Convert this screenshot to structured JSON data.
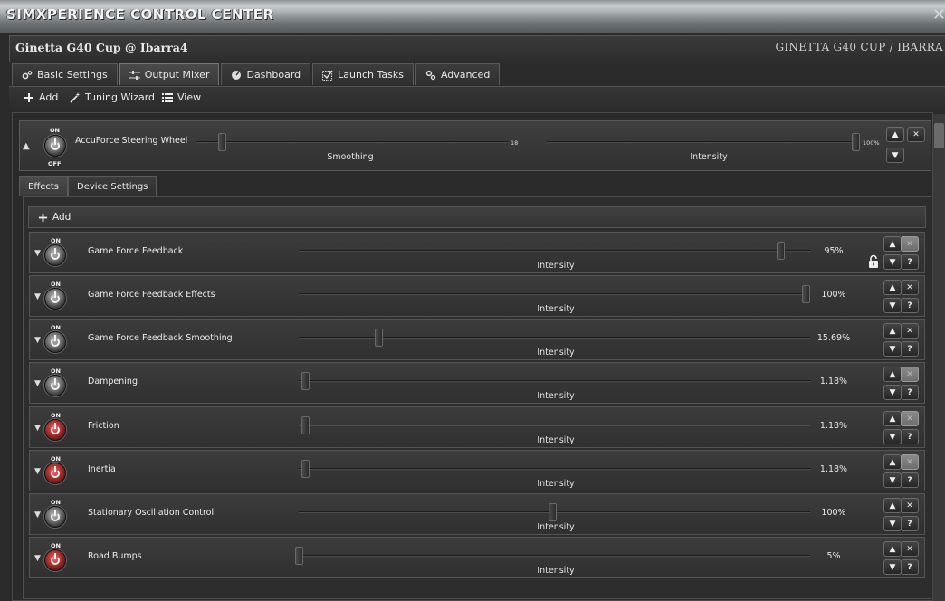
{
  "window": {
    "title": "SIMXPERIENCE CONTROL CENTER",
    "close": "✕"
  },
  "header": {
    "profile": "Ginetta G40 Cup @ Ibarra4",
    "profile_right": "GINETTA G40 CUP / IBARRA"
  },
  "tabs": [
    {
      "label": "Basic Settings",
      "icon": "gears-icon"
    },
    {
      "label": "Output Mixer",
      "icon": "sliders-icon",
      "active": true
    },
    {
      "label": "Dashboard",
      "icon": "gauge-icon"
    },
    {
      "label": "Launch Tasks",
      "icon": "checklist-icon"
    },
    {
      "label": "Advanced",
      "icon": "gears-icon"
    }
  ],
  "toolbar": {
    "add": "Add",
    "wizard": "Tuning Wizard",
    "view": "View"
  },
  "device": {
    "on": "ON",
    "off": "OFF",
    "name": "AccuForce Steering Wheel",
    "smoothing_value": "18",
    "smoothing_label": "Smoothing",
    "smoothing_level": 0.08,
    "intensity_value": "100%",
    "intensity_label": "Intensity",
    "intensity_level": 1.0
  },
  "panel_tabs": {
    "effects": "Effects",
    "device_settings": "Device Settings"
  },
  "effects_add": "Add",
  "effects": [
    {
      "on": "ON",
      "name": "Game Force Feedback",
      "value": "95%",
      "level": 0.95,
      "caption": "Intensity",
      "state": "gray",
      "x_disabled": true,
      "locked": true
    },
    {
      "on": "ON",
      "name": "Game Force Feedback Effects",
      "value": "100%",
      "level": 1.0,
      "caption": "Intensity",
      "state": "gray",
      "x_disabled": false,
      "locked": false
    },
    {
      "on": "ON",
      "name": "Game Force Feedback Smoothing",
      "value": "15.69%",
      "level": 0.1569,
      "caption": "Intensity",
      "state": "gray",
      "x_disabled": false,
      "locked": false
    },
    {
      "on": "ON",
      "name": "Dampening",
      "value": "1.18%",
      "level": 0.0118,
      "caption": "Intensity",
      "state": "gray",
      "x_disabled": true,
      "locked": false
    },
    {
      "on": "ON",
      "name": "Friction",
      "value": "1.18%",
      "level": 0.0118,
      "caption": "Intensity",
      "state": "red",
      "x_disabled": true,
      "locked": false
    },
    {
      "on": "ON",
      "name": "Inertia",
      "value": "1.18%",
      "level": 0.0118,
      "caption": "Intensity",
      "state": "red",
      "x_disabled": true,
      "locked": false
    },
    {
      "on": "ON",
      "name": "Stationary Oscillation Control",
      "value": "100%",
      "level": 0.5,
      "caption": "Intensity",
      "state": "gray",
      "x_disabled": false,
      "locked": false
    },
    {
      "on": "ON",
      "name": "Road Bumps",
      "value": "5%",
      "level": 0.0,
      "caption": "Intensity",
      "state": "red",
      "x_disabled": false,
      "locked": false
    }
  ],
  "buttons": {
    "up": "▲",
    "down": "▼",
    "close": "✕",
    "help": "?"
  }
}
